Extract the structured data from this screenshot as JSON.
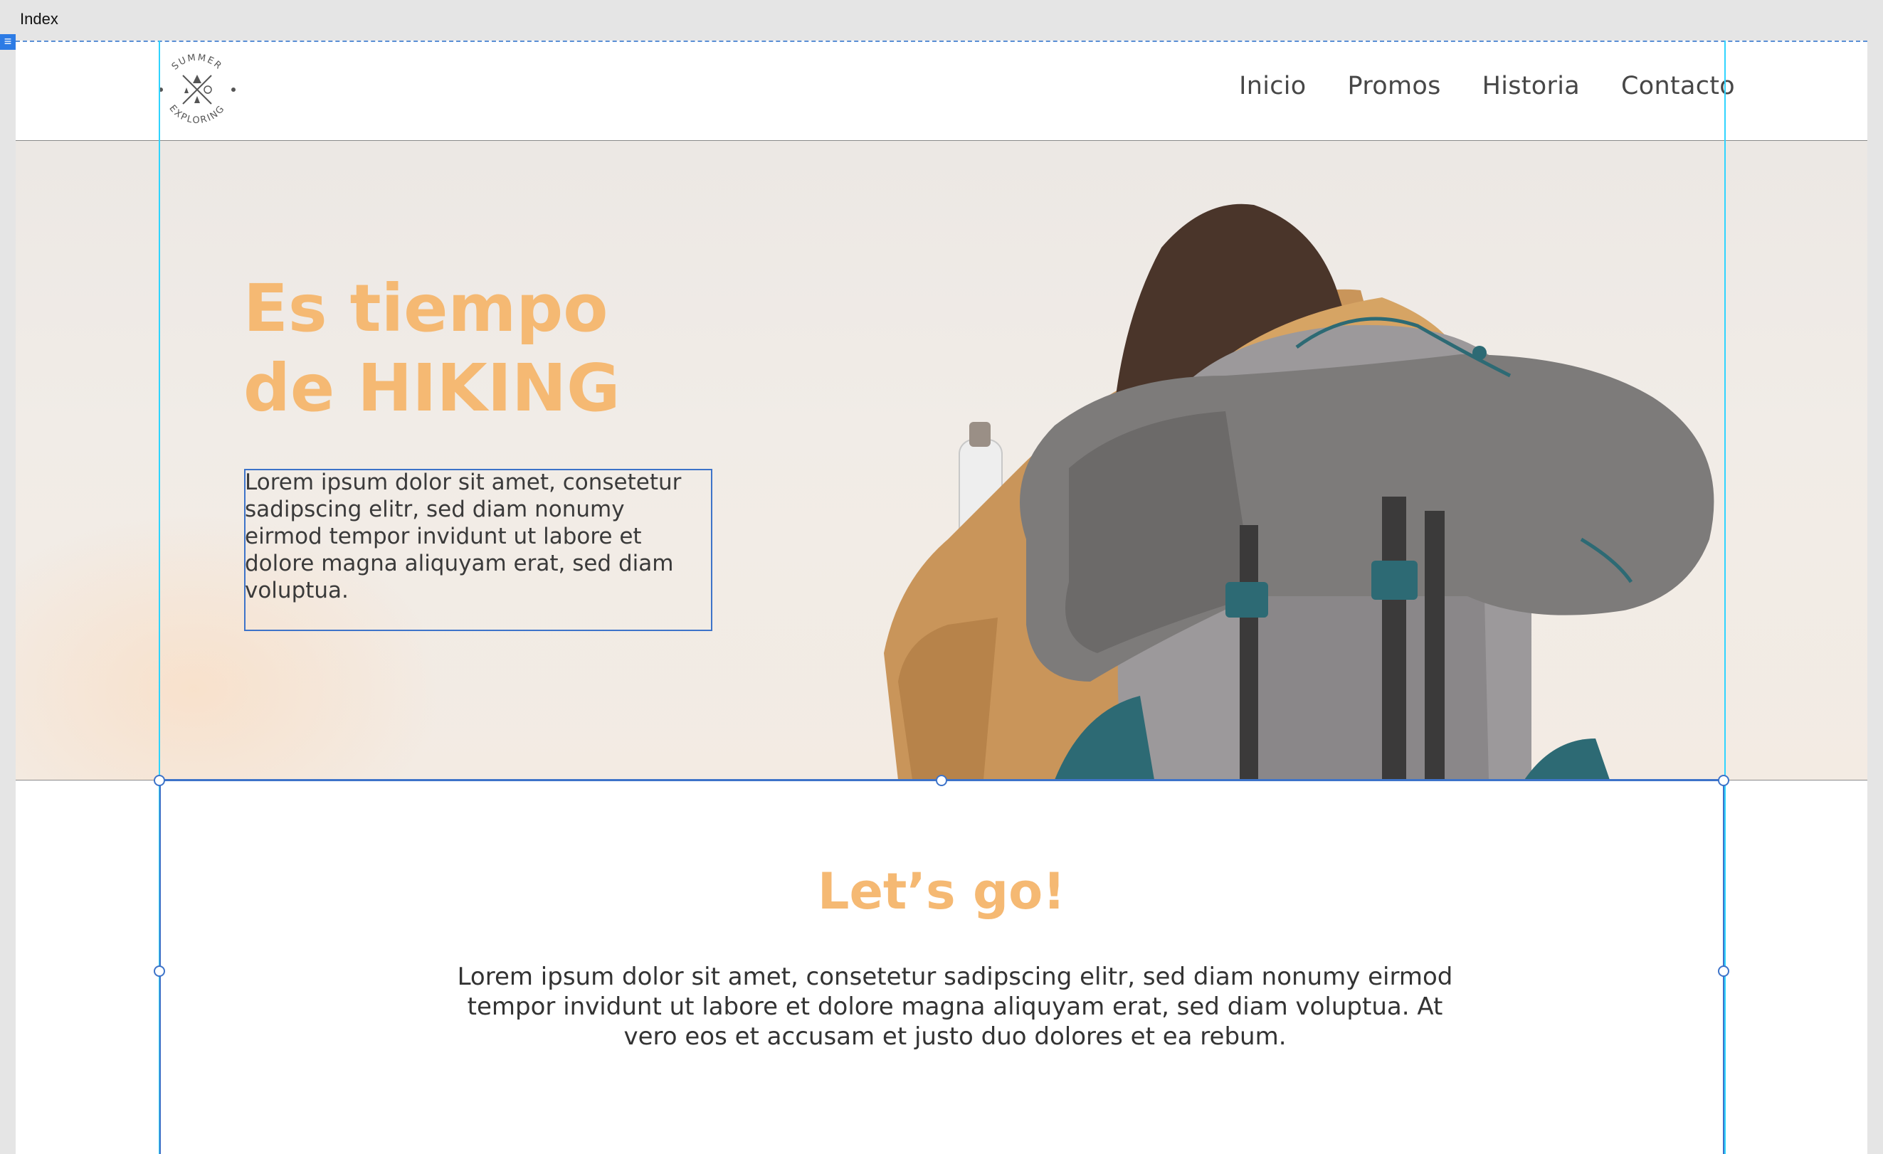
{
  "artboard": {
    "label": "Index"
  },
  "logo": {
    "text_top": "SUMMER",
    "text_bottom": "EXPLORING"
  },
  "nav": {
    "items": [
      "Inicio",
      "Promos",
      "Historia",
      "Contacto"
    ]
  },
  "hero": {
    "title_line1": "Es tiempo",
    "title_line2": "de HIKING",
    "body": "Lorem ipsum dolor sit amet, consetetur sadipscing elitr, sed diam nonumy eirmod tempor invidunt ut labore et dolore magna aliquyam erat, sed diam voluptua."
  },
  "section": {
    "title": "Let’s go!",
    "body": "Lorem ipsum dolor sit amet, consetetur sadipscing elitr, sed diam nonumy eirmod tempor invidunt ut labore et dolore magna aliquyam erat, sed diam voluptua. At vero eos et accusam et justo duo dolores et ea rebum."
  },
  "colors": {
    "accent": "#f5b973",
    "guide": "#2fd4ff",
    "selection": "#3d73c9",
    "canvas": "#e5e5e5"
  }
}
